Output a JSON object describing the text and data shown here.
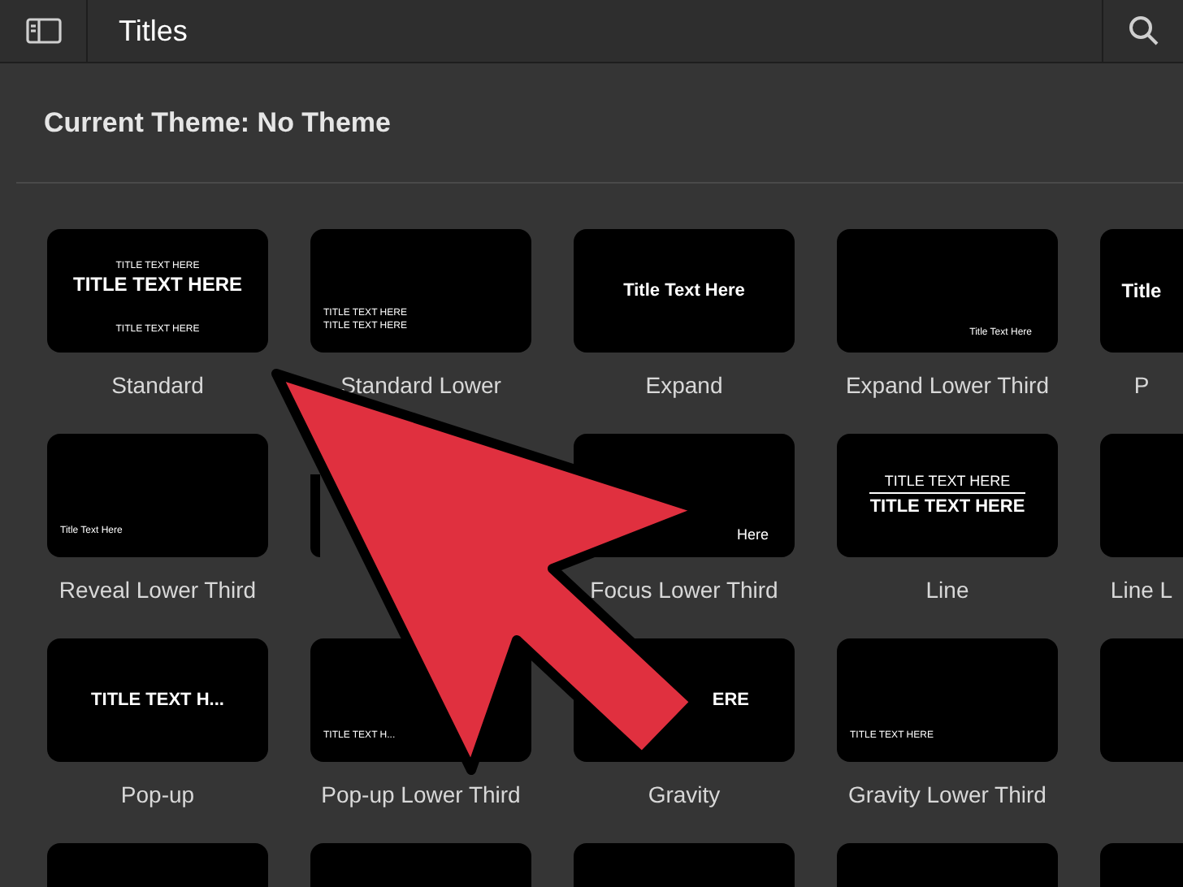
{
  "header": {
    "title": "Titles"
  },
  "theme_heading": "Current Theme: No Theme",
  "tiles": [
    {
      "label": "Standard",
      "kind": "spread",
      "lines": [
        {
          "text": "TITLE TEXT HERE",
          "kind": "tiny"
        },
        {
          "text": "TITLE TEXT HERE",
          "kind": "large"
        },
        {
          "text": "TITLE TEXT HERE",
          "kind": "tiny"
        }
      ]
    },
    {
      "label": "Standard Lower",
      "kind": "lower-left",
      "lines": [
        {
          "text": "TITLE TEXT HERE",
          "kind": "tiny"
        },
        {
          "text": "TITLE TEXT HERE",
          "kind": "tiny"
        }
      ]
    },
    {
      "label": "Expand",
      "kind": "center",
      "lines": [
        {
          "text": "Title Text Here",
          "kind": "medium"
        }
      ]
    },
    {
      "label": "Expand Lower Third",
      "kind": "lower-right",
      "lines": [
        {
          "text": "Title Text Here",
          "kind": "tiny"
        }
      ]
    },
    {
      "label": "P",
      "kind": "center",
      "lines": [
        {
          "text": "Title",
          "kind": "large"
        }
      ]
    },
    {
      "label": "Reveal Lower Third",
      "kind": "lower-left",
      "lines": [
        {
          "text": "Title Text Here",
          "kind": "tiny"
        }
      ]
    },
    {
      "kind": "covered"
    },
    {
      "label": "Focus Lower Third",
      "kind": "lower-right",
      "lines": [
        {
          "text": "Here",
          "kind": "small"
        }
      ]
    },
    {
      "label": "Line",
      "kind": "line",
      "lines": [
        {
          "text": "TITLE TEXT HERE",
          "kind": "small"
        },
        {
          "text": "TITLE TEXT HERE",
          "kind": "medium"
        }
      ]
    },
    {
      "label": "Line L",
      "kind": "blank"
    },
    {
      "label": "Pop-up",
      "kind": "center",
      "lines": [
        {
          "text": "TITLE TEXT H...",
          "kind": "medium"
        }
      ]
    },
    {
      "label": "Pop-up Lower Third",
      "kind": "lower-left",
      "lines": [
        {
          "text": "TITLE TEXT H...",
          "kind": "tiny"
        }
      ]
    },
    {
      "label": "Gravity",
      "kind": "mid-right",
      "lines": [
        {
          "text": "ERE",
          "kind": "medium"
        }
      ]
    },
    {
      "label": "Gravity Lower Third",
      "kind": "lower-left",
      "lines": [
        {
          "text": "TITLE TEXT HERE",
          "kind": "tiny"
        }
      ]
    },
    {
      "kind": "blank"
    },
    {
      "kind": "blank"
    },
    {
      "kind": "blank"
    },
    {
      "kind": "blank"
    },
    {
      "kind": "blank"
    },
    {
      "kind": "blank"
    }
  ]
}
